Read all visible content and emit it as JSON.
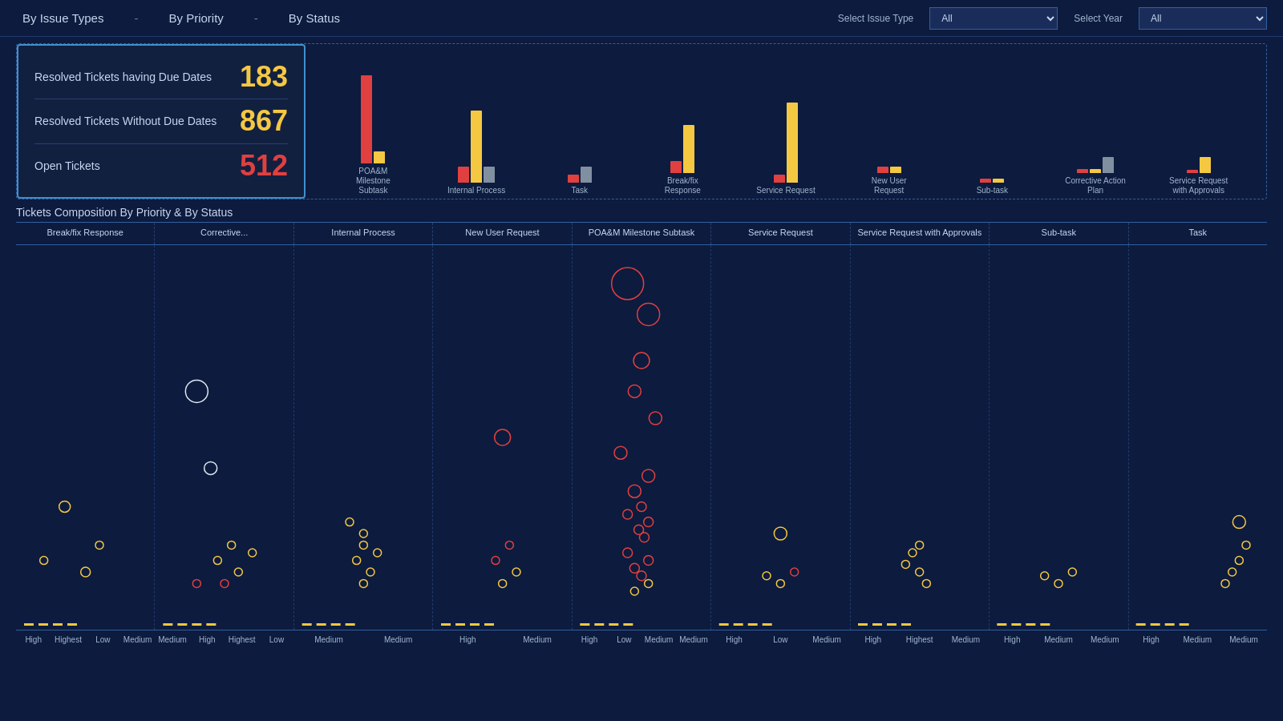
{
  "header": {
    "tabs": [
      {
        "label": "By Issue Types",
        "active": false
      },
      {
        "label": "By Priority",
        "active": false
      },
      {
        "label": "By Status",
        "active": false
      }
    ],
    "select_issue_type_label": "Select Issue Type",
    "select_issue_type_value": "All",
    "select_year_label": "Select Year",
    "select_year_value": "All"
  },
  "summary": {
    "resolved_with_due_dates_label": "Resolved Tickets having Due Dates",
    "resolved_with_due_dates_value": "183",
    "resolved_without_due_dates_label": "Resolved Tickets Without Due Dates",
    "resolved_without_due_dates_value": "867",
    "open_tickets_label": "Open Tickets",
    "open_tickets_value": "512"
  },
  "bar_chart": {
    "groups": [
      {
        "label": "POA&M Milestone\nSubtask",
        "red_height": 110,
        "yellow_height": 15,
        "gray_height": 0
      },
      {
        "label": "Internal Process",
        "red_height": 20,
        "yellow_height": 90,
        "gray_height": 20
      },
      {
        "label": "Task",
        "red_height": 10,
        "yellow_height": 0,
        "gray_height": 20
      },
      {
        "label": "Break/fix Response",
        "red_height": 15,
        "yellow_height": 60,
        "gray_height": 0
      },
      {
        "label": "Service Request",
        "red_height": 10,
        "yellow_height": 100,
        "gray_height": 0
      },
      {
        "label": "New User Request",
        "red_height": 8,
        "yellow_height": 8,
        "gray_height": 0
      },
      {
        "label": "Sub-task",
        "red_height": 5,
        "yellow_height": 5,
        "gray_height": 0
      },
      {
        "label": "Corrective Action\nPlan",
        "red_height": 5,
        "yellow_height": 5,
        "gray_height": 20
      },
      {
        "label": "Service Request\nwith Approvals",
        "red_height": 4,
        "yellow_height": 20,
        "gray_height": 0
      }
    ]
  },
  "scatter": {
    "title": "Tickets Composition By Priority & By Status",
    "columns": [
      "Break/fix Response",
      "Corrective...",
      "Internal Process",
      "New User Request",
      "POA&M Milestone Subtask",
      "Service Request",
      "Service Request with Approvals",
      "Sub-task",
      "Task"
    ],
    "x_labels": [
      "High",
      "Highest",
      "Low",
      "Medium",
      "Medium",
      "High",
      "Highest",
      "Low",
      "Medium",
      "Medium",
      "High",
      "Medium",
      "High",
      "Low",
      "Medium",
      "Medium",
      "High",
      "Low",
      "Medium",
      "High",
      "Medium",
      "High",
      "Highest",
      "Medium",
      "High",
      "Medium",
      "Medium"
    ]
  },
  "colors": {
    "bg": "#0d1b3e",
    "accent_blue": "#4090d0",
    "red": "#e04040",
    "gold": "#f5c842",
    "gray": "#8090a0"
  }
}
